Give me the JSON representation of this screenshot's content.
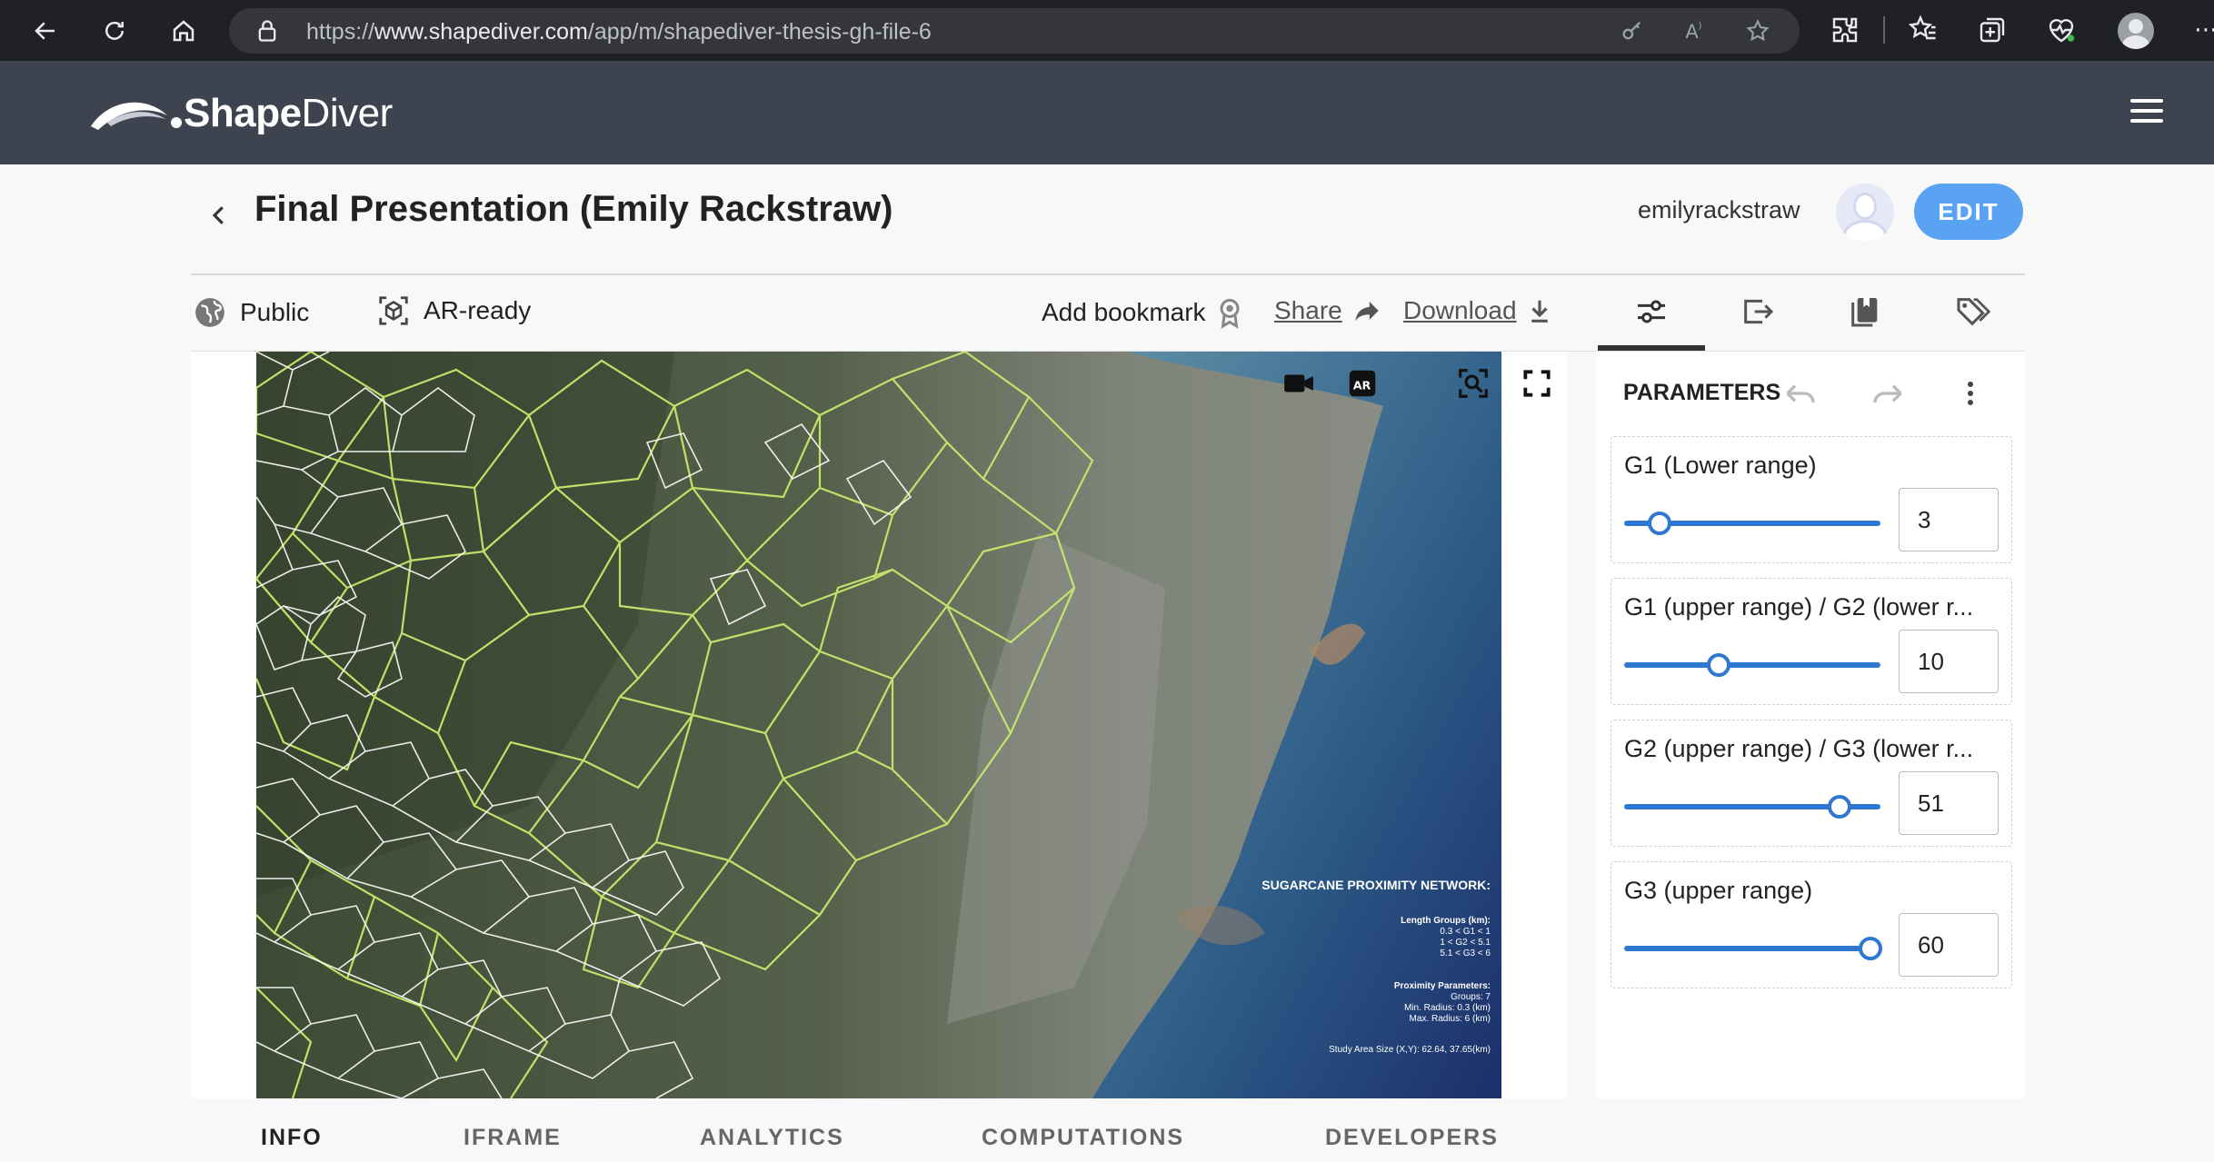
{
  "browser": {
    "url_prefix": "https://",
    "url_domain": "www.shapediver.com",
    "url_path": "/app/m/shapediver-thesis-gh-file-6"
  },
  "app": {
    "logo_light": "Shape",
    "logo_bold": "Diver"
  },
  "model": {
    "title": "Final Presentation (Emily Rackstraw)",
    "username": "emilyrackstraw",
    "edit_label": "EDIT",
    "visibility": "Public",
    "ar_status": "AR-ready",
    "add_bookmark": "Add bookmark",
    "share": "Share",
    "download": "Download"
  },
  "map_legend": {
    "title": "SUGARCANE PROXIMITY NETWORK:",
    "length_groups_title": "Length Groups (km):",
    "length_groups": [
      "0.3 < G1 < 1",
      "1 < G2 < 5.1",
      "5.1 < G3 < 6"
    ],
    "proximity_title": "Proximity Parameters:",
    "proximity": [
      "Groups: 7",
      "Min. Radius: 0.3 (km)",
      "Max. Radius: 6 (km)"
    ],
    "study_area": "Study Area Size (X,Y): 62.64, 37.65(km)"
  },
  "parameters": {
    "title": "PARAMETERS",
    "items": [
      {
        "label": "G1 (Lower range)",
        "value": "3",
        "level": 0.14
      },
      {
        "label": "G1 (upper range) / G2 (lower r...",
        "value": "10",
        "level": 0.37
      },
      {
        "label": "G2 (upper range) / G3 (lower r...",
        "value": "51",
        "level": 0.84
      },
      {
        "label": "G3 (upper range)",
        "value": "60",
        "level": 0.96
      }
    ]
  },
  "bottom_tabs": [
    "INFO",
    "IFRAME",
    "ANALYTICS",
    "COMPUTATIONS",
    "DEVELOPERS"
  ],
  "colors": {
    "header": "#3e4350",
    "accent": "#5aa3f2",
    "slider": "#2f78d1",
    "network_green": "#c8e86b",
    "network_white": "#ffffff"
  }
}
